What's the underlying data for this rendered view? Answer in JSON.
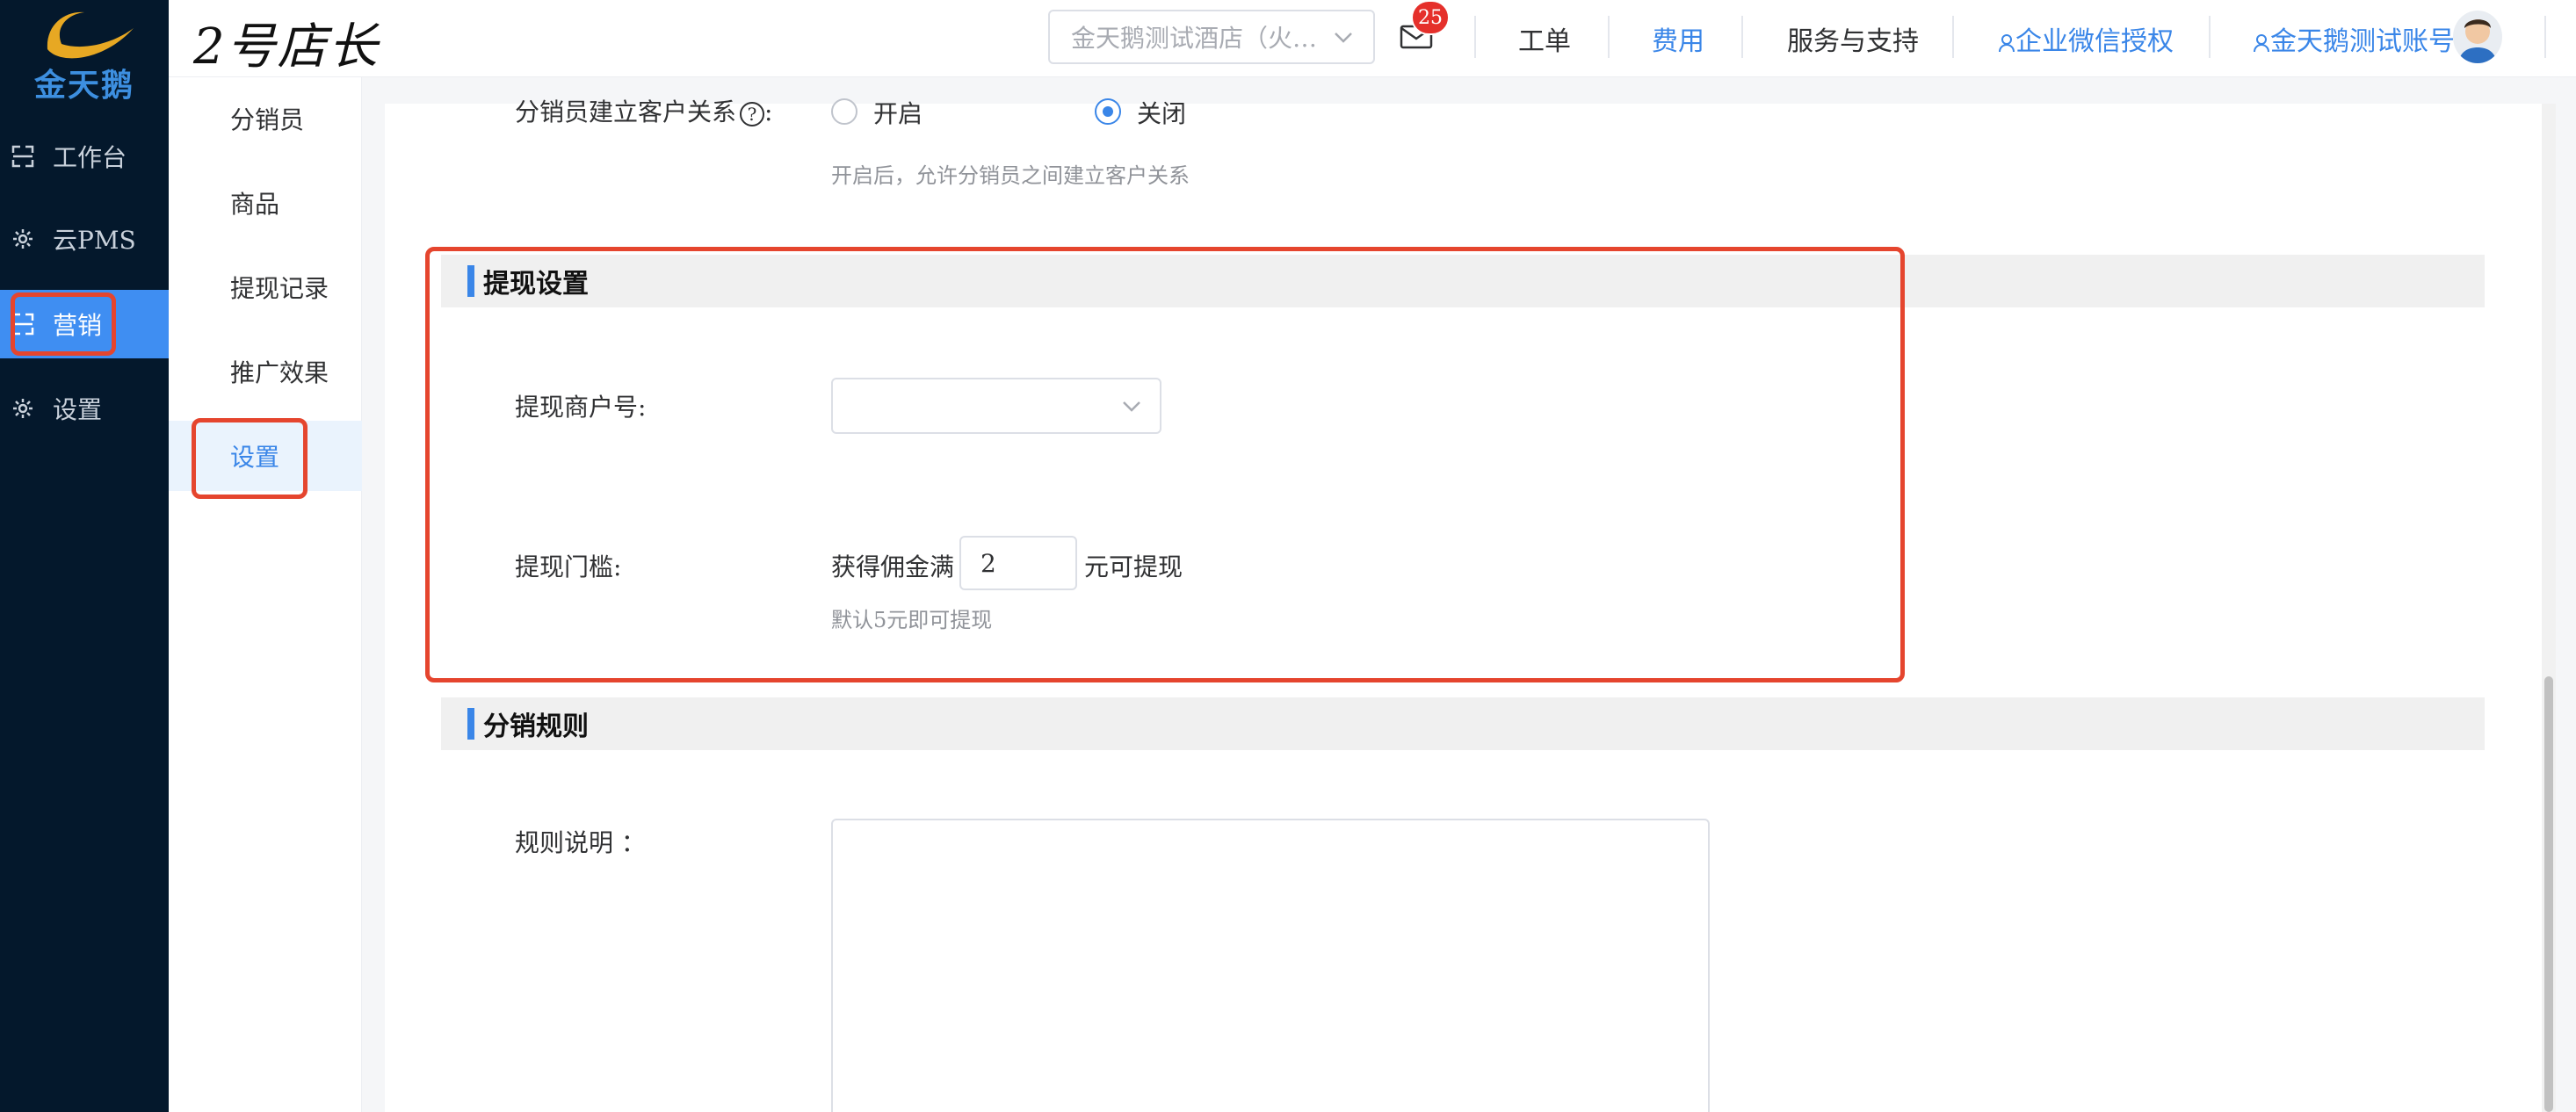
{
  "brand_logo_text": "金天鹅",
  "app_title": "2号店长",
  "left_nav": [
    {
      "label": "工作台",
      "icon": "workbench-icon"
    },
    {
      "label": "云PMS",
      "icon": "gear-icon"
    },
    {
      "label": "营销",
      "icon": "marketing-icon",
      "active": true
    },
    {
      "label": "设置",
      "icon": "gear-icon"
    }
  ],
  "header": {
    "hotel_select": "金天鹅测试酒店（火…",
    "mail_badge": "25",
    "links": {
      "ticket": "工单",
      "fees": "费用",
      "support": "服务与支持",
      "wechat_auth": "企业微信授权",
      "account": "金天鹅测试账号"
    }
  },
  "sub_nav": [
    {
      "label": "分销员"
    },
    {
      "label": "商品"
    },
    {
      "label": "提现记录"
    },
    {
      "label": "推广效果"
    },
    {
      "label": "设置",
      "active": true
    }
  ],
  "form": {
    "relation": {
      "label": "分销员建立客户关系",
      "option_on": "开启",
      "option_off": "关闭",
      "selected": "关闭",
      "hint": "开启后，允许分销员之间建立客户关系"
    },
    "withdraw": {
      "section_title": "提现设置",
      "merchant_label": "提现商户号:",
      "merchant_value": "",
      "threshold_label": "提现门槛:",
      "threshold_prefix": "获得佣金满",
      "threshold_value": "2",
      "threshold_suffix": "元可提现",
      "threshold_hint": "默认5元即可提现"
    },
    "rules": {
      "section_title": "分销规则",
      "label": "规则说明 ："
    }
  },
  "colors": {
    "accent": "#3a86e8",
    "highlight": "#e5452e",
    "sidebar_bg": "#04182c"
  }
}
